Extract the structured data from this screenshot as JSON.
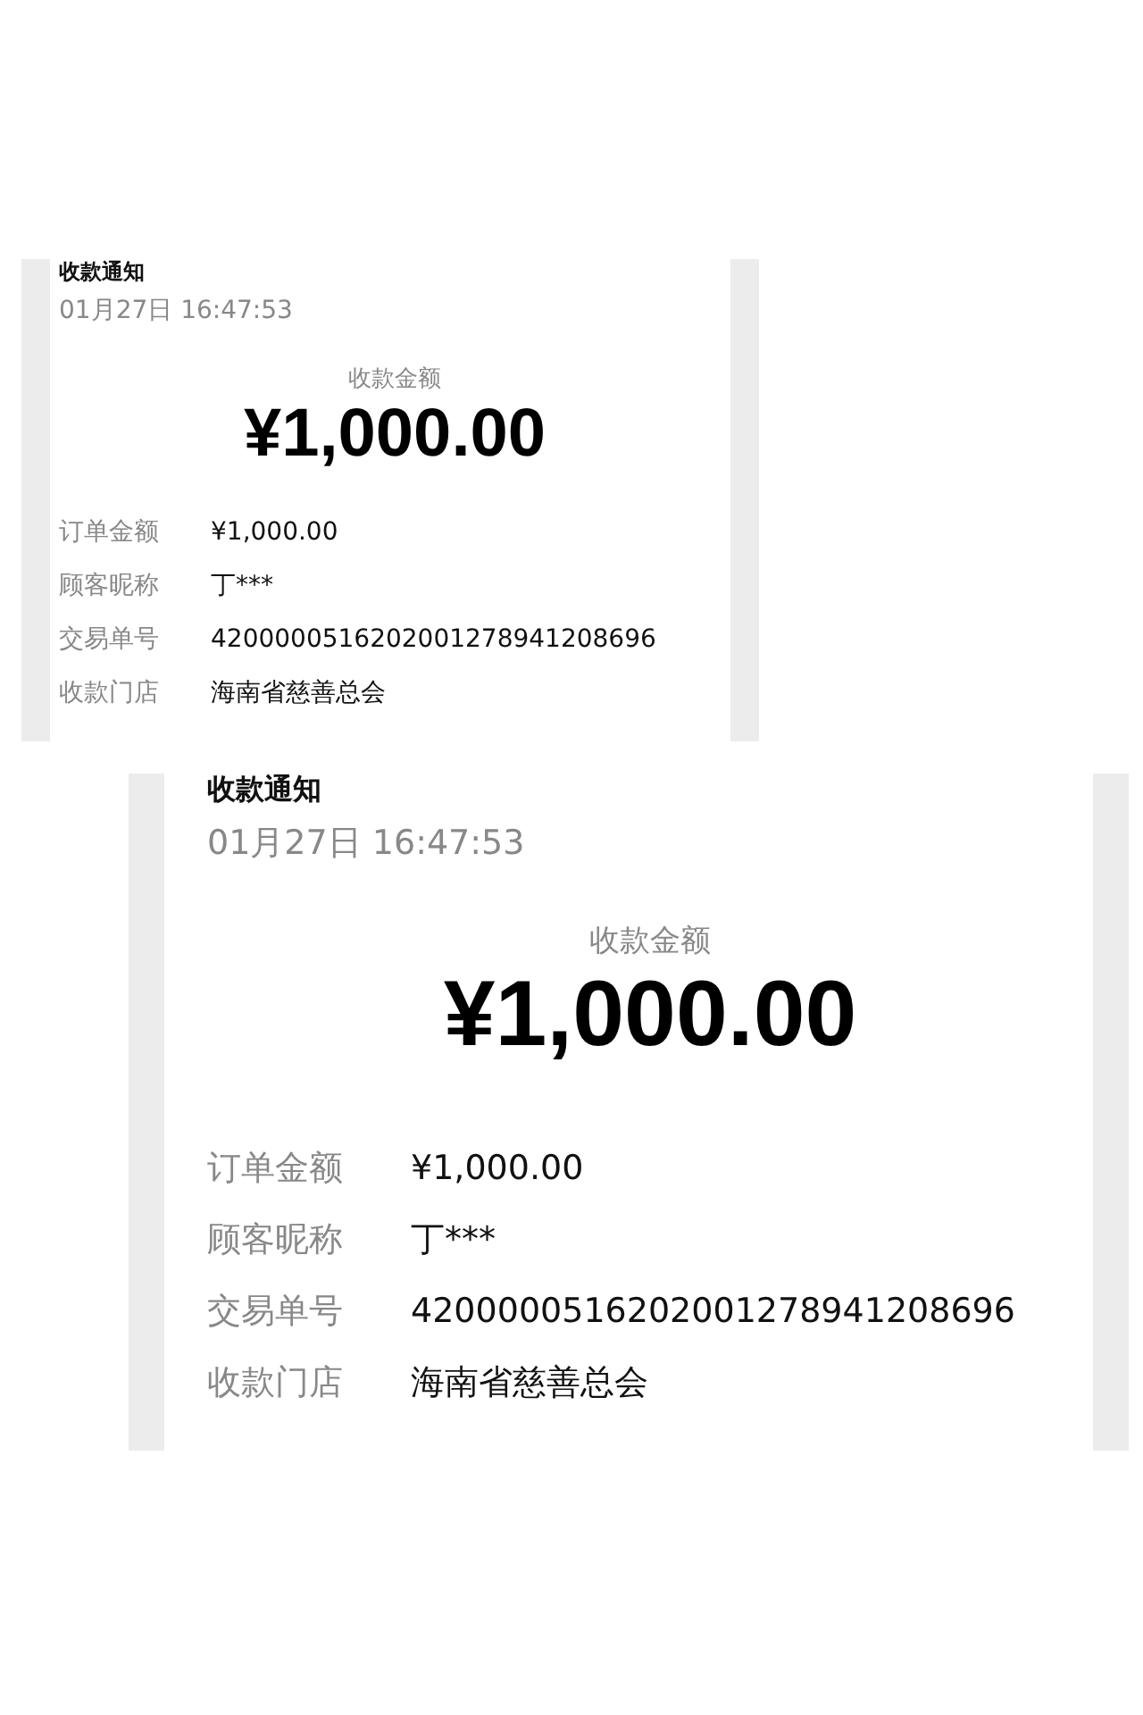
{
  "screenshots": [
    {
      "title": "收款通知",
      "time": "01月27日 16:47:53",
      "amount_label": "收款金额",
      "amount": "¥1,000.00",
      "details": [
        {
          "label": "订单金额",
          "value": "¥1,000.00"
        },
        {
          "label": "顾客昵称",
          "value": "丁***"
        },
        {
          "label": "交易单号",
          "value": "4200000516202001278941208696"
        },
        {
          "label": "收款门店",
          "value": "海南省慈善总会"
        }
      ]
    },
    {
      "title": "收款通知",
      "time": "01月27日 16:47:53",
      "amount_label": "收款金额",
      "amount": "¥1,000.00",
      "details": [
        {
          "label": "订单金额",
          "value": "¥1,000.00"
        },
        {
          "label": "顾客昵称",
          "value": "丁***"
        },
        {
          "label": "交易单号",
          "value": "4200000516202001278941208696"
        },
        {
          "label": "收款门店",
          "value": "海南省慈善总会"
        }
      ]
    }
  ]
}
